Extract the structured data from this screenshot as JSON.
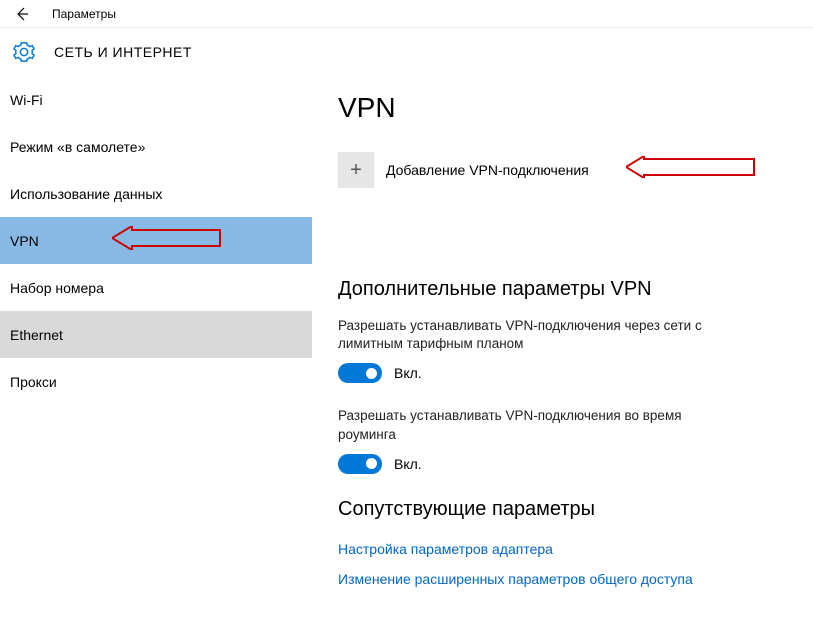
{
  "titlebar": {
    "title": "Параметры"
  },
  "header": {
    "title": "СЕТЬ И ИНТЕРНЕТ"
  },
  "sidebar": {
    "items": [
      {
        "label": "Wi-Fi"
      },
      {
        "label": "Режим «в самолете»"
      },
      {
        "label": "Использование данных"
      },
      {
        "label": "VPN"
      },
      {
        "label": "Набор номера"
      },
      {
        "label": "Ethernet"
      },
      {
        "label": "Прокси"
      }
    ]
  },
  "main": {
    "page_title": "VPN",
    "add_vpn_label": "Добавление VPN-подключения",
    "advanced_title": "Дополнительные параметры VPN",
    "setting1_desc": "Разрешать устанавливать VPN-подключения через сети с лимитным тарифным планом",
    "setting1_state": "Вкл.",
    "setting2_desc": "Разрешать устанавливать VPN-подключения во время роуминга",
    "setting2_state": "Вкл.",
    "related_title": "Сопутствующие параметры",
    "link1": "Настройка параметров адаптера",
    "link2": "Изменение расширенных параметров общего доступа"
  }
}
